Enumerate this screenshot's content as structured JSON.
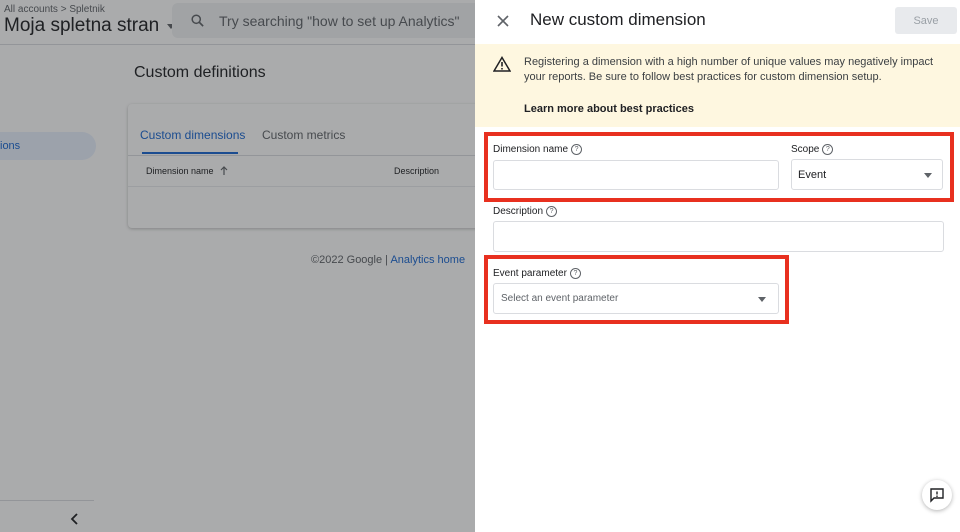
{
  "header": {
    "breadcrumb": "All accounts > Spletnik",
    "property_name": "Moja spletna stran",
    "search_placeholder": "Try searching \"how to set up Analytics\""
  },
  "nav": {
    "active_item_fragment": "ions"
  },
  "page": {
    "title": "Custom definitions",
    "tabs": [
      {
        "label": "Custom dimensions",
        "active": true
      },
      {
        "label": "Custom metrics",
        "active": false
      }
    ],
    "columns": [
      "Dimension name",
      "Description"
    ],
    "sort_icon": "arrow-up-icon",
    "footer_text": "©2022 Google | ",
    "footer_link": "Analytics home"
  },
  "panel": {
    "title": "New custom dimension",
    "save_label": "Save",
    "warning_text": "Registering a dimension with a high number of unique values may negatively impact your reports. Be sure to follow best practices for custom dimension setup.",
    "warning_link": "Learn more about best practices",
    "fields": {
      "dimension_name": {
        "label": "Dimension name",
        "value": ""
      },
      "scope": {
        "label": "Scope",
        "value": "Event"
      },
      "description": {
        "label": "Description",
        "value": ""
      },
      "event_parameter": {
        "label": "Event parameter",
        "placeholder": "Select an event parameter"
      }
    }
  },
  "colors": {
    "accent": "#1967d2",
    "highlight": "#e8301f",
    "warning_bg": "#fef7e0"
  }
}
